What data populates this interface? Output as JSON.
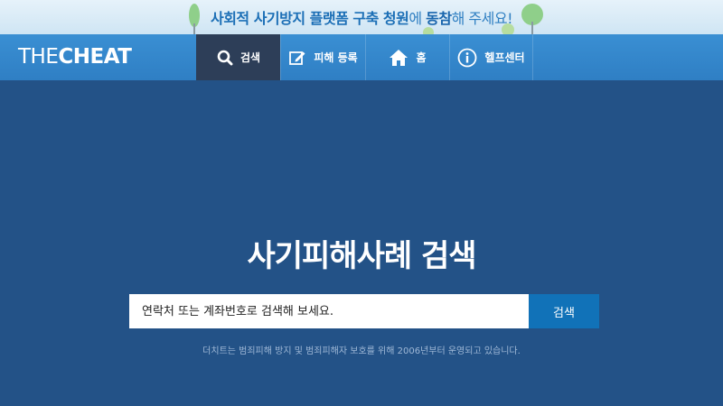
{
  "banner": {
    "part1": "사회적 사기방지 플랫폼 구축 청원",
    "part2": "에 ",
    "part3": "동참",
    "part4": "해 주세요!"
  },
  "navbar": {
    "logo_light": "THE",
    "logo_bold": "CHEAT",
    "items": [
      {
        "label": "검색",
        "icon": "search-icon"
      },
      {
        "label": "피해 등록",
        "icon": "edit-icon"
      },
      {
        "label": "홈",
        "icon": "home-icon"
      },
      {
        "label": "헬프센터",
        "icon": "info-icon"
      }
    ]
  },
  "hero": {
    "title": "사기피해사례 검색",
    "search_placeholder": "연락처 또는 계좌번호로 검색해 보세요.",
    "search_button": "검색",
    "caption": "더치트는 범죄피해 방지 및 범죄피해자 보호를 위해 2006년부터 운영되고 있습니다."
  },
  "colors": {
    "background": "#235287",
    "nav": "#3285c8",
    "nav_active": "#2d3e58",
    "search_button": "#1172b8"
  }
}
